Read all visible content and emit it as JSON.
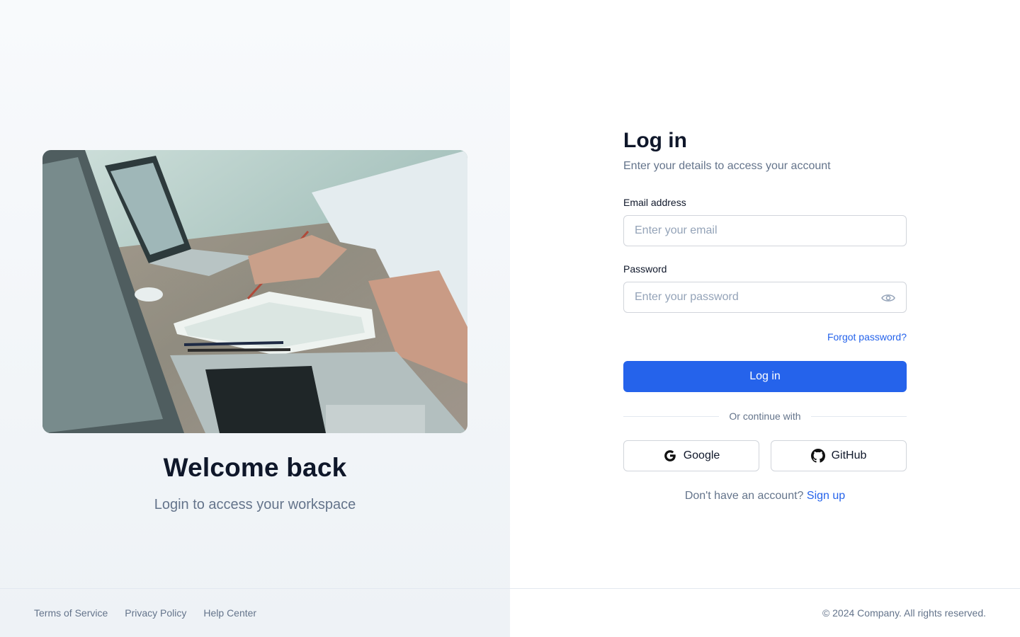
{
  "left": {
    "image": {
      "name": "workspace-photo",
      "description_icon": "laptops-desk-photo"
    },
    "title": "Welcome back",
    "subtitle": "Login to access your workspace",
    "footer_links": [
      "Terms of Service",
      "Privacy Policy",
      "Help Center"
    ]
  },
  "form": {
    "title": "Log in",
    "subtitle": "Enter your details to access your account",
    "email": {
      "label": "Email address",
      "placeholder": "Enter your email",
      "value": ""
    },
    "password": {
      "label": "Password",
      "placeholder": "Enter your password",
      "value": "",
      "toggle_icon": "eye-icon"
    },
    "forgot_label": "Forgot password?",
    "submit_label": "Log in",
    "divider_text": "Or continue with",
    "social": [
      {
        "label": "Google",
        "icon": "google-icon"
      },
      {
        "label": "GitHub",
        "icon": "github-icon"
      }
    ],
    "signup_prompt": "Don't have an account?",
    "signup_link": "Sign up"
  },
  "footer": {
    "copyright": "© 2024 Company. All rights reserved."
  },
  "colors": {
    "primary": "#2563eb",
    "text_dark": "#0f172a",
    "text_muted": "#64748b",
    "border": "#d1d5db"
  }
}
